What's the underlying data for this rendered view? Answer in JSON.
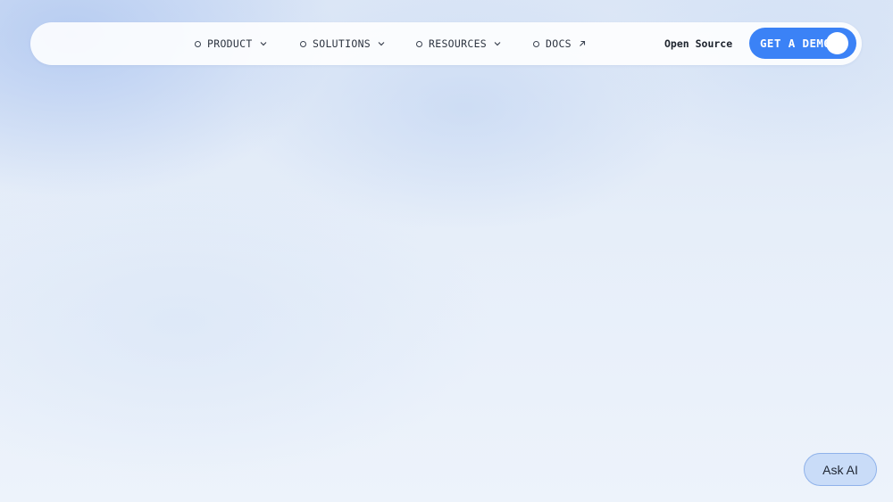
{
  "nav": {
    "items": [
      {
        "label": "PRODUCT",
        "icon": "chevron-down-icon"
      },
      {
        "label": "SOLUTIONS",
        "icon": "chevron-down-icon"
      },
      {
        "label": "RESOURCES",
        "icon": "chevron-down-icon"
      },
      {
        "label": "DOCS",
        "icon": "external-arrow-icon"
      }
    ],
    "open_source_label": "Open Source",
    "demo_button_label": "GET A DEMO"
  },
  "ask_ai": {
    "label": "Ask AI"
  },
  "colors": {
    "accent": "#3b82f6",
    "ask_ai_bg": "#c9dcf8"
  }
}
